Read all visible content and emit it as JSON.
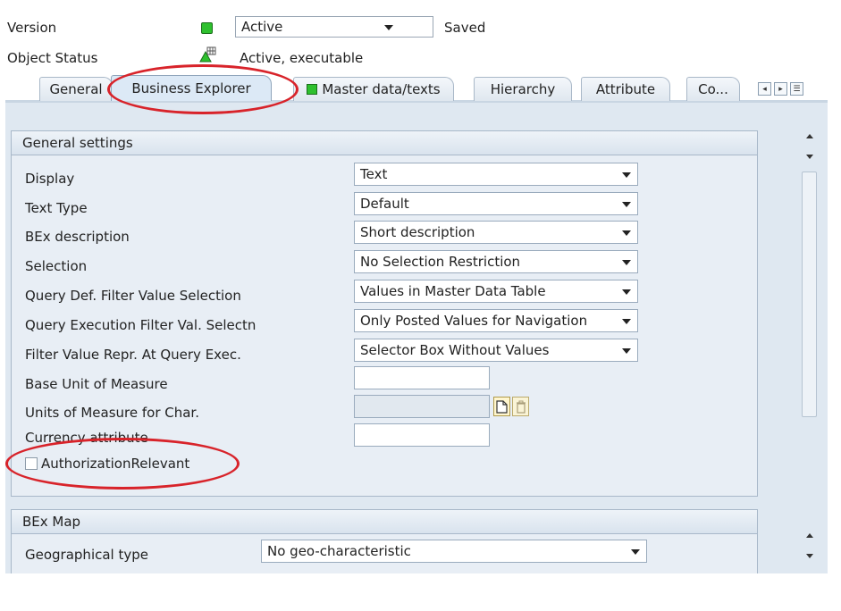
{
  "header": {
    "version_label": "Version",
    "version_value": "Active",
    "version_state": "Saved",
    "object_status_label": "Object Status",
    "object_status_value": "Active, executable"
  },
  "tabs": [
    {
      "label": "General"
    },
    {
      "label": "Business Explorer"
    },
    {
      "label": "Master data/texts"
    },
    {
      "label": "Hierarchy"
    },
    {
      "label": "Attribute"
    },
    {
      "label": "Co..."
    }
  ],
  "general_settings": {
    "title": "General settings",
    "rows": [
      {
        "label": "Display",
        "value": "Text"
      },
      {
        "label": "Text Type",
        "value": "Default"
      },
      {
        "label": "BEx description",
        "value": "Short description"
      },
      {
        "label": "Selection",
        "value": "No Selection Restriction"
      },
      {
        "label": "Query Def. Filter Value Selection",
        "value": "Values in Master Data Table"
      },
      {
        "label": "Query Execution Filter Val. Selectn",
        "value": "Only Posted Values for Navigation"
      },
      {
        "label": "Filter Value Repr. At Query Exec.",
        "value": "Selector Box Without Values"
      },
      {
        "label": "Base Unit of Measure",
        "value": ""
      },
      {
        "label": "Units of Measure for Char.",
        "value": ""
      },
      {
        "label": "Currency attribute",
        "value": ""
      }
    ],
    "authorization_label": "AuthorizationRelevant",
    "authorization_checked": false
  },
  "bex_map": {
    "title": "BEx Map",
    "geo_label": "Geographical type",
    "geo_value": "No geo-characteristic"
  },
  "colors": {
    "status_green": "#2ec02e",
    "annotation_red": "#d8232a"
  }
}
